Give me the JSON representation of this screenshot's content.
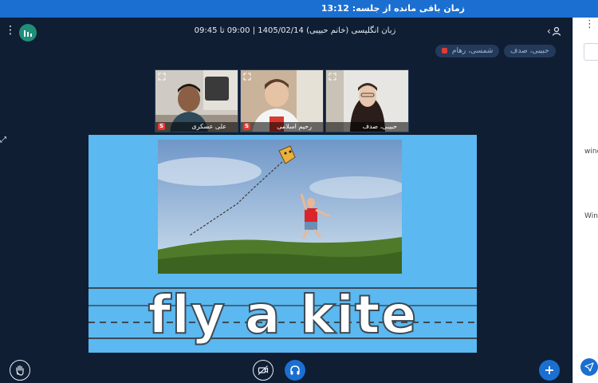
{
  "banner": {
    "text": "زمان باقی مانده از جلسه: 13:12"
  },
  "session": {
    "title": "زبان انگلیسی (خانم حبیبی) 1405/02/14 | 09:00 تا 09:45"
  },
  "chips": [
    {
      "label": "حبیبی، صدف"
    },
    {
      "label": "شمسی، رهام"
    }
  ],
  "videos": [
    {
      "name": "علی عسکری"
    },
    {
      "name": "رحیم اسلامی"
    },
    {
      "name": "حبیبی، صدف"
    }
  ],
  "slide": {
    "caption": "fly a kite"
  },
  "right_panel": {
    "label_1": "wind",
    "label_2": "Wind"
  },
  "colors": {
    "banner": "#1b6fd1",
    "background": "#0f1e33",
    "accent": "#1b6fd1",
    "stats": "#1f8f7a",
    "slide": "#5bb8f0"
  },
  "icons": {
    "kebab": "more-vertical-icon",
    "stats": "bar-chart-icon",
    "user": "user-icon",
    "raise_hand": "hand-icon",
    "camera": "camera-off-icon",
    "headphones": "headphones-icon",
    "add": "plus-icon",
    "send": "send-icon"
  }
}
